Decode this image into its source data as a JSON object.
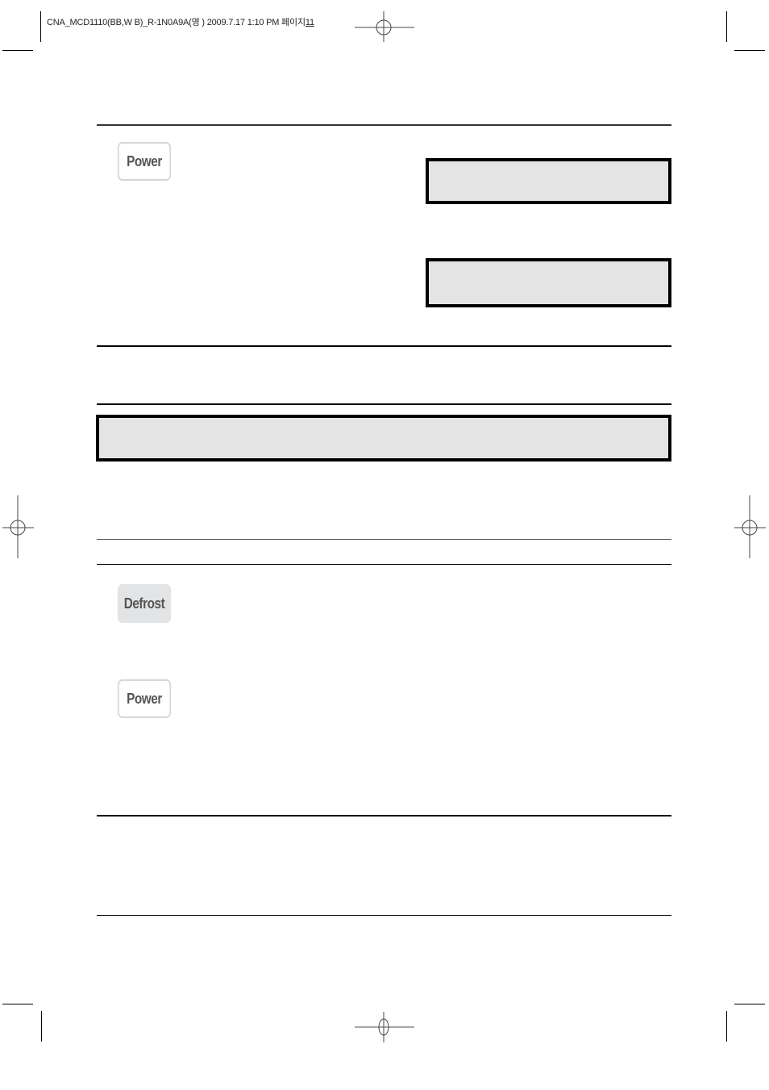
{
  "header": {
    "slug_text": "CNA_MCD1110(BB,W B)_R-1N0A9A(영 ) 2009.7.17 1:10 PM 페이지",
    "page_number": "11"
  },
  "sections": [
    {
      "id": "power-section",
      "button_label": "Power",
      "display_boxes": [
        "",
        ""
      ]
    },
    {
      "id": "notice-section",
      "display_box_text": ""
    },
    {
      "id": "defrost-section",
      "buttons": [
        {
          "label": "Defrost",
          "style": "filled"
        },
        {
          "label": "Power",
          "style": "outline"
        }
      ]
    }
  ],
  "colors": {
    "display_fill": "#e4e4e4",
    "button_text": "#555555",
    "button_border": "#d6d6d6",
    "defrost_fill": "#e3e4e6"
  }
}
